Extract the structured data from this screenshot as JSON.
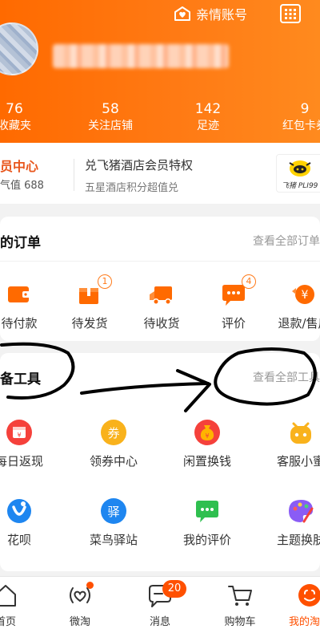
{
  "header": {
    "family_account": "亲情账号",
    "stats": [
      {
        "num": "76",
        "label": "收藏夹"
      },
      {
        "num": "58",
        "label": "关注店铺"
      },
      {
        "num": "142",
        "label": "足迹"
      },
      {
        "num": "9",
        "label": "红包卡券"
      }
    ]
  },
  "member": {
    "title": "员中心",
    "value": "气值 688",
    "line1": "兑飞猪酒店会员特权",
    "line2": "五星酒店积分超值兑",
    "thumb_text": "飞猪 PLI99"
  },
  "orders": {
    "title": "的订单",
    "view_all": "查看全部订单",
    "items": [
      {
        "label": "待付款",
        "icon": "wallet-icon"
      },
      {
        "label": "待发货",
        "icon": "package-icon",
        "badge": "1"
      },
      {
        "label": "待收货",
        "icon": "truck-icon"
      },
      {
        "label": "评价",
        "icon": "comment-icon",
        "badge": "4"
      },
      {
        "label": "退款/售后",
        "icon": "refund-icon"
      }
    ]
  },
  "tools": {
    "title": "备工具",
    "view_all": "查看全部工具",
    "items": [
      {
        "label": "每日返现",
        "icon": "calendar-icon"
      },
      {
        "label": "领券中心",
        "icon": "coupon-icon",
        "glyph": "券"
      },
      {
        "label": "闲置换钱",
        "icon": "money-bag-icon"
      },
      {
        "label": "客服小蜜",
        "icon": "bot-icon"
      },
      {
        "label": "花呗",
        "icon": "huabei-icon"
      },
      {
        "label": "菜鸟驿站",
        "icon": "station-icon",
        "glyph": "驿"
      },
      {
        "label": "我的评价",
        "icon": "review-icon"
      },
      {
        "label": "主题换肤",
        "icon": "palette-icon"
      }
    ]
  },
  "tabbar": {
    "tabs": [
      {
        "label": "首页",
        "icon": "home-icon"
      },
      {
        "label": "微淘",
        "icon": "weitao-icon"
      },
      {
        "label": "消息",
        "icon": "message-icon",
        "count": "20"
      },
      {
        "label": "购物车",
        "icon": "cart-icon"
      },
      {
        "label": "我的淘宝",
        "icon": "me-icon",
        "active": true
      }
    ]
  },
  "colors": {
    "brand": "#ff6a00",
    "accent": "#ff5000",
    "red_icon": "#f5413b",
    "yellow_icon": "#f9b21c",
    "blue_icon": "#1e86f0",
    "green_icon": "#2fbf4f"
  }
}
